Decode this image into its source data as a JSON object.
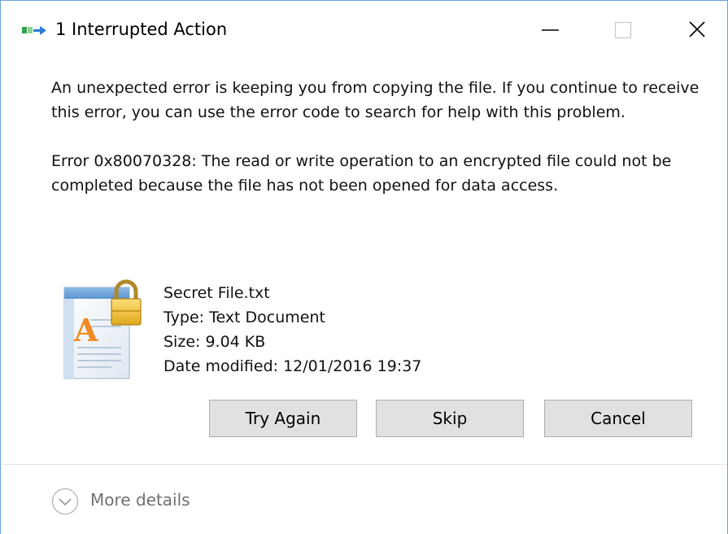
{
  "window": {
    "title": "1 Interrupted Action"
  },
  "message": {
    "line1": "An unexpected error is keeping you from copying the file. If you continue to receive this error, you can use the error code to search for help with this problem.",
    "error": "Error 0x80070328: The read or write operation to an encrypted file could not be completed because the file has not been opened for data access."
  },
  "file": {
    "name": "Secret File.txt",
    "type": "Type: Text Document",
    "size": "Size: 9.04 KB",
    "modified": "Date modified: 12/01/2016 19:37",
    "icon": "encrypted-text-file-icon"
  },
  "buttons": {
    "try_again": "Try Again",
    "skip": "Skip",
    "cancel": "Cancel"
  },
  "footer": {
    "details_label": "More details"
  },
  "colors": {
    "window_border": "#6aa3d8",
    "button_bg": "#e1e1e1",
    "button_border": "#adadad",
    "details_text": "#707070"
  }
}
